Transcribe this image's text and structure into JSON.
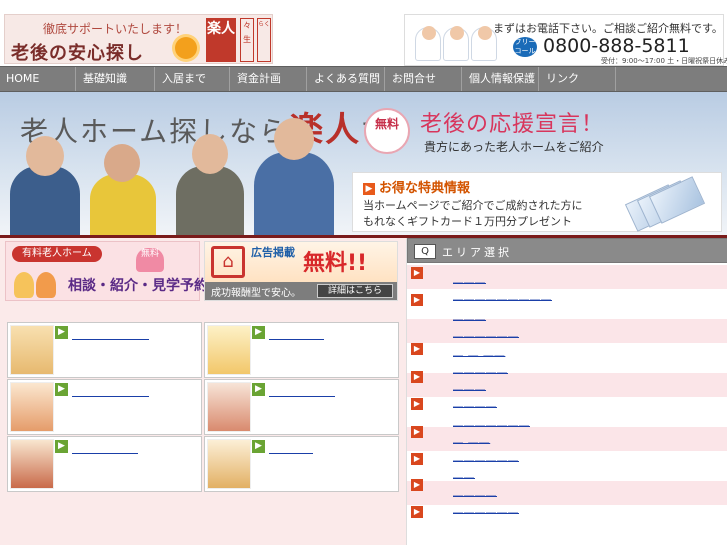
{
  "header": {
    "tagline": "徹底サポートいたします！",
    "logo_text": "老後の安心探し",
    "brand": "楽人",
    "brand_side1": "らく",
    "brand_side2": "々 生",
    "call_message": "まずはお電話下さい。ご相談ご紹介無料です。",
    "freecall_badge": "フリーコール",
    "phone": "0800-888-5811",
    "hours": "受付：9:00〜17:00 土・日曜祝祭日休み"
  },
  "nav": {
    "items": [
      "HOME",
      "基礎知識",
      "入居まで",
      "資金計画",
      "よくある質問",
      "お問合せ",
      "個人情報保護",
      "リンク"
    ]
  },
  "banner": {
    "title_pre": "老人ホーム探しなら",
    "title_brand": "楽人",
    "title_post": "で",
    "badge": "無料",
    "slogan": "老後の応援宣言！",
    "subcopy": "貴方にあった老人ホームをご紹介",
    "tokuten_title": "お得な特典情報",
    "tokuten_line1": "当ホームページでご紹介でご成約された方に",
    "tokuten_line2": "もれなくギフトカード１万円分プレゼント"
  },
  "ads": {
    "ad1_header": "有料老人ホーム",
    "ad1_badge": "無料",
    "ad1_text": "相談・紹介・見学予約",
    "ad2_kokoku": "広告掲載",
    "ad2_free": "無料!!",
    "ad2_sub": "成功報酬型で安心。",
    "ad2_button": "詳細はこちら"
  },
  "cards": [
    {
      "link": "＿＿＿＿＿＿＿"
    },
    {
      "link": "＿＿＿＿＿"
    },
    {
      "link": "＿＿＿＿＿＿＿"
    },
    {
      "link": "＿＿＿＿＿＿"
    },
    {
      "link": "＿＿＿＿＿＿"
    },
    {
      "link": "＿＿＿＿"
    }
  ],
  "area": {
    "title": "エリア選択",
    "search_icon_label": "Q",
    "rows": [
      {
        "lines": [
          "＿＿＿",
          "＿＿＿＿＿＿＿＿＿"
        ]
      },
      {
        "lines": [
          "＿＿＿",
          "＿＿＿＿＿＿"
        ]
      },
      {
        "lines": [
          "＿ ＿ ＿＿",
          "＿＿＿＿＿"
        ]
      },
      {
        "lines": [
          "＿＿＿",
          "＿＿＿＿"
        ]
      },
      {
        "lines": [
          "＿＿＿＿＿＿＿",
          "＿ ＿＿"
        ]
      },
      {
        "lines": [
          "＿＿＿＿＿＿",
          "＿＿"
        ]
      },
      {
        "lines": [
          "＿＿＿＿",
          "＿＿＿＿＿＿"
        ]
      }
    ]
  },
  "colors": {
    "nav_bg": "#7d7d7d",
    "brand_red": "#c0392b",
    "link": "#1a3fa8",
    "rule": "#7a1b1b"
  }
}
